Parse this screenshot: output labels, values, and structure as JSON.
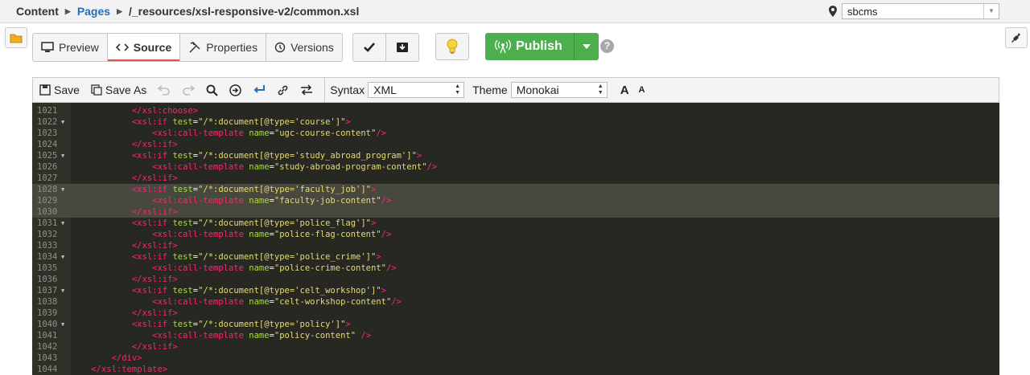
{
  "breadcrumb": {
    "root": "Content",
    "section": "Pages",
    "path": "/_resources/xsl-responsive-v2/common.xsl"
  },
  "site_selector": {
    "value": "sbcms"
  },
  "view_tabs": [
    {
      "label": "Preview",
      "icon": "monitor-icon"
    },
    {
      "label": "Source",
      "icon": "code-icon",
      "active": true
    },
    {
      "label": "Properties",
      "icon": "tools-icon"
    },
    {
      "label": "Versions",
      "icon": "history-icon"
    }
  ],
  "publish": {
    "label": "Publish",
    "color": "#4cae4c"
  },
  "help": {
    "label": "?"
  },
  "editor_toolbar": {
    "save_label": "Save",
    "save_as_label": "Save As",
    "syntax_label": "Syntax",
    "syntax_value": "XML",
    "theme_label": "Theme",
    "theme_value": "Monokai",
    "font_larger": "A",
    "font_smaller": "A"
  },
  "editor_theme": {
    "background": "#272822",
    "tag": "#f92672",
    "attr": "#a6e22e",
    "string": "#e6db74",
    "highlight": "#49483e"
  },
  "code_lines": [
    {
      "num": "1021",
      "fold": false,
      "hl": false,
      "indent": "            ",
      "tokens": [
        [
          "t",
          "</xsl:choose>"
        ]
      ]
    },
    {
      "num": "1022",
      "fold": true,
      "hl": false,
      "indent": "            ",
      "tokens": [
        [
          "t",
          "<xsl:if "
        ],
        [
          "a",
          "test"
        ],
        [
          "p",
          "="
        ],
        [
          "s",
          "\"/*:document[@type='course']\""
        ],
        [
          "t",
          ">"
        ]
      ]
    },
    {
      "num": "1023",
      "fold": false,
      "hl": false,
      "indent": "                ",
      "tokens": [
        [
          "t",
          "<xsl:call-template "
        ],
        [
          "a",
          "name"
        ],
        [
          "p",
          "="
        ],
        [
          "s",
          "\"ugc-course-content\""
        ],
        [
          "t",
          "/>"
        ]
      ]
    },
    {
      "num": "1024",
      "fold": false,
      "hl": false,
      "indent": "            ",
      "tokens": [
        [
          "t",
          "</xsl:if>"
        ]
      ]
    },
    {
      "num": "1025",
      "fold": true,
      "hl": false,
      "indent": "            ",
      "tokens": [
        [
          "t",
          "<xsl:if "
        ],
        [
          "a",
          "test"
        ],
        [
          "p",
          "="
        ],
        [
          "s",
          "\"/*:document[@type='study_abroad_program']\""
        ],
        [
          "t",
          ">"
        ]
      ]
    },
    {
      "num": "1026",
      "fold": false,
      "hl": false,
      "indent": "                ",
      "tokens": [
        [
          "t",
          "<xsl:call-template "
        ],
        [
          "a",
          "name"
        ],
        [
          "p",
          "="
        ],
        [
          "s",
          "\"study-abroad-program-content\""
        ],
        [
          "t",
          "/>"
        ]
      ]
    },
    {
      "num": "1027",
      "fold": false,
      "hl": false,
      "indent": "            ",
      "tokens": [
        [
          "t",
          "</xsl:if>"
        ]
      ]
    },
    {
      "num": "1028",
      "fold": true,
      "hl": true,
      "indent": "            ",
      "tokens": [
        [
          "t",
          "<xsl:if "
        ],
        [
          "a",
          "test"
        ],
        [
          "p",
          "="
        ],
        [
          "s",
          "\"/*:document[@type='faculty_job']\""
        ],
        [
          "t",
          ">"
        ]
      ]
    },
    {
      "num": "1029",
      "fold": false,
      "hl": true,
      "indent": "                ",
      "tokens": [
        [
          "t",
          "<xsl:call-template "
        ],
        [
          "a",
          "name"
        ],
        [
          "p",
          "="
        ],
        [
          "s",
          "\"faculty-job-content\""
        ],
        [
          "t",
          "/>"
        ]
      ]
    },
    {
      "num": "1030",
      "fold": false,
      "hl": true,
      "indent": "            ",
      "tokens": [
        [
          "t",
          "</xsl:if>"
        ]
      ]
    },
    {
      "num": "1031",
      "fold": true,
      "hl": false,
      "indent": "            ",
      "tokens": [
        [
          "t",
          "<xsl:if "
        ],
        [
          "a",
          "test"
        ],
        [
          "p",
          "="
        ],
        [
          "s",
          "\"/*:document[@type='police_flag']\""
        ],
        [
          "t",
          ">"
        ]
      ]
    },
    {
      "num": "1032",
      "fold": false,
      "hl": false,
      "indent": "                ",
      "tokens": [
        [
          "t",
          "<xsl:call-template "
        ],
        [
          "a",
          "name"
        ],
        [
          "p",
          "="
        ],
        [
          "s",
          "\"police-flag-content\""
        ],
        [
          "t",
          "/>"
        ]
      ]
    },
    {
      "num": "1033",
      "fold": false,
      "hl": false,
      "indent": "            ",
      "tokens": [
        [
          "t",
          "</xsl:if>"
        ]
      ]
    },
    {
      "num": "1034",
      "fold": true,
      "hl": false,
      "indent": "            ",
      "tokens": [
        [
          "t",
          "<xsl:if "
        ],
        [
          "a",
          "test"
        ],
        [
          "p",
          "="
        ],
        [
          "s",
          "\"/*:document[@type='police_crime']\""
        ],
        [
          "t",
          ">"
        ]
      ]
    },
    {
      "num": "1035",
      "fold": false,
      "hl": false,
      "indent": "                ",
      "tokens": [
        [
          "t",
          "<xsl:call-template "
        ],
        [
          "a",
          "name"
        ],
        [
          "p",
          "="
        ],
        [
          "s",
          "\"police-crime-content\""
        ],
        [
          "t",
          "/>"
        ]
      ]
    },
    {
      "num": "1036",
      "fold": false,
      "hl": false,
      "indent": "            ",
      "tokens": [
        [
          "t",
          "</xsl:if>"
        ]
      ]
    },
    {
      "num": "1037",
      "fold": true,
      "hl": false,
      "indent": "            ",
      "tokens": [
        [
          "t",
          "<xsl:if "
        ],
        [
          "a",
          "test"
        ],
        [
          "p",
          "="
        ],
        [
          "s",
          "\"/*:document[@type='celt_workshop']\""
        ],
        [
          "t",
          ">"
        ]
      ]
    },
    {
      "num": "1038",
      "fold": false,
      "hl": false,
      "indent": "                ",
      "tokens": [
        [
          "t",
          "<xsl:call-template "
        ],
        [
          "a",
          "name"
        ],
        [
          "p",
          "="
        ],
        [
          "s",
          "\"celt-workshop-content\""
        ],
        [
          "t",
          "/>"
        ]
      ]
    },
    {
      "num": "1039",
      "fold": false,
      "hl": false,
      "indent": "            ",
      "tokens": [
        [
          "t",
          "</xsl:if>"
        ]
      ]
    },
    {
      "num": "1040",
      "fold": true,
      "hl": false,
      "indent": "            ",
      "tokens": [
        [
          "t",
          "<xsl:if "
        ],
        [
          "a",
          "test"
        ],
        [
          "p",
          "="
        ],
        [
          "s",
          "\"/*:document[@type='policy']\""
        ],
        [
          "t",
          ">"
        ]
      ]
    },
    {
      "num": "1041",
      "fold": false,
      "hl": false,
      "indent": "                ",
      "tokens": [
        [
          "t",
          "<xsl:call-template "
        ],
        [
          "a",
          "name"
        ],
        [
          "p",
          "="
        ],
        [
          "s",
          "\"policy-content\""
        ],
        [
          "p",
          " "
        ],
        [
          "t",
          "/>"
        ]
      ]
    },
    {
      "num": "1042",
      "fold": false,
      "hl": false,
      "indent": "            ",
      "tokens": [
        [
          "t",
          "</xsl:if>"
        ]
      ]
    },
    {
      "num": "1043",
      "fold": false,
      "hl": false,
      "indent": "        ",
      "tokens": [
        [
          "t",
          "</div>"
        ]
      ]
    },
    {
      "num": "1044",
      "fold": false,
      "hl": false,
      "indent": "    ",
      "tokens": [
        [
          "t",
          "</xsl:template>"
        ]
      ]
    }
  ]
}
